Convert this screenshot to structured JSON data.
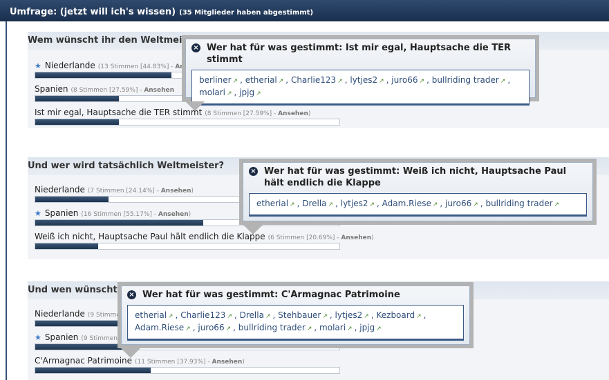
{
  "header": {
    "title": "Umfrage: (jetzt will ich's wissen)",
    "count": "(35 Mitglieder haben abgestimmt)"
  },
  "polls": [
    {
      "question": "Wem wünscht ihr den Weltmeistert",
      "options": [
        {
          "label": "Niederlande",
          "meta": "(13 Stimmen [44.83%] - ",
          "link": "Ansehen",
          "starred": true,
          "percent": 44.83
        },
        {
          "label": "Spanien",
          "meta": "(8 Stimmen [27.59%] - ",
          "link": "Ansehen",
          "starred": false,
          "percent": 27.59
        },
        {
          "label": "Ist mir egal, Hauptsache die TER stimmt",
          "meta": "(8 Stimmen [27.59%] - ",
          "link": "Ansehen",
          "close": ")",
          "starred": false,
          "percent": 27.59
        }
      ],
      "popup": {
        "title": "Wer hat für was gestimmt: Ist mir egal, Hauptsache die TER stimmt",
        "users": [
          "berliner",
          "etherial",
          "Charlie123",
          "lytjes2",
          "juro66",
          "bullriding trader",
          "molari",
          "jpjg"
        ]
      }
    },
    {
      "question": "Und wer wird tatsächlich Weltmeister?",
      "options": [
        {
          "label": "Niederlande",
          "meta": "(7 Stimmen [24.14%] - ",
          "link": "Ansehen",
          "close": ")",
          "starred": false,
          "percent": 24.14
        },
        {
          "label": "Spanien",
          "meta": "(16 Stimmen [55.17%] - ",
          "link": "Ansehen",
          "close": ")",
          "starred": true,
          "percent": 55.17
        },
        {
          "label": "Weiß ich nicht, Hauptsache Paul hält endlich die Klappe",
          "meta": "(6 Stimmen [20.69%] - ",
          "link": "Ansehen",
          "close": ")",
          "starred": false,
          "percent": 20.69
        }
      ],
      "popup": {
        "title": "Wer hat für was gestimmt: Weiß ich nicht, Hauptsache Paul hält endlich die Klappe",
        "users": [
          "etherial",
          "Drella",
          "lytjes2",
          "Adam.Riese",
          "juro66",
          "bullriding trader"
        ]
      }
    },
    {
      "question": "Und wen wünscht sic",
      "options": [
        {
          "label": "Niederlande",
          "meta": "(9 Stimmen",
          "link": "",
          "starred": false,
          "percent": 31.03
        },
        {
          "label": "Spanien",
          "meta": "(9 Stimmen",
          "link": "",
          "starred": true,
          "percent": 31.03
        },
        {
          "label": "C'Armagnac Patrimoine",
          "meta": "(11 Stimmen [37.93%] - ",
          "link": "Ansehen",
          "close": ")",
          "starred": false,
          "percent": 37.93
        }
      ],
      "popup": {
        "title": "Wer hat für was gestimmt: C'Armagnac Patrimoine",
        "users": [
          "etherial",
          "Charlie123",
          "Drella",
          "Stehbauer",
          "lytjes2",
          "Kezboard",
          "Adam.Riese",
          "juro66",
          "bullriding trader",
          "molari",
          "jpjg"
        ]
      }
    }
  ]
}
